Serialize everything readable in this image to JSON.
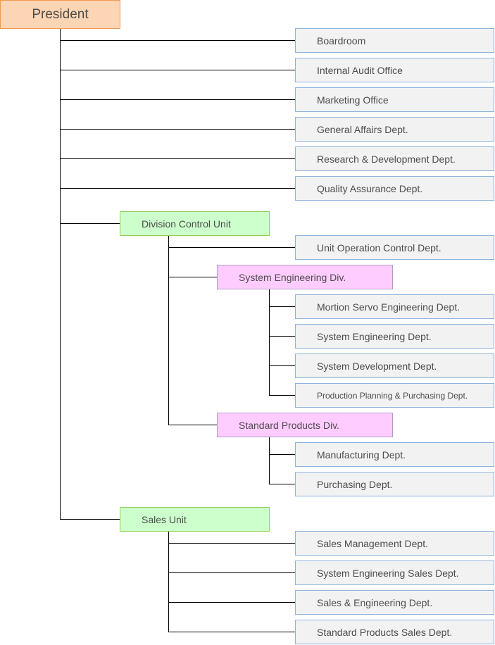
{
  "president": "President",
  "direct_depts": [
    "Boardroom",
    "Internal Audit Office",
    "Marketing Office",
    "General Affairs Dept.",
    "Research & Development Dept.",
    "Quality Assurance Dept."
  ],
  "division_control_unit": {
    "label": "Division Control Unit",
    "unit_operation": "Unit Operation Control Dept.",
    "system_engineering_div": {
      "label": "System Engineering Div.",
      "depts": [
        "Mortion Servo Engineering Dept.",
        "System Engineering Dept.",
        "System Development Dept.",
        "Production Planning & Purchasing Dept."
      ]
    },
    "standard_products_div": {
      "label": "Standard Products Div.",
      "depts": [
        "Manufacturing Dept.",
        "Purchasing Dept."
      ]
    }
  },
  "sales_unit": {
    "label": "Sales Unit",
    "depts": [
      "Sales Management Dept.",
      "System Engineering Sales Dept.",
      "Sales & Engineering Dept.",
      "Standard Products Sales Dept."
    ]
  },
  "colors": {
    "president_fill": "#fcd5b4",
    "unit_fill": "#ccffcc",
    "division_fill": "#ffccff",
    "dept_fill": "#f2f2f2"
  }
}
